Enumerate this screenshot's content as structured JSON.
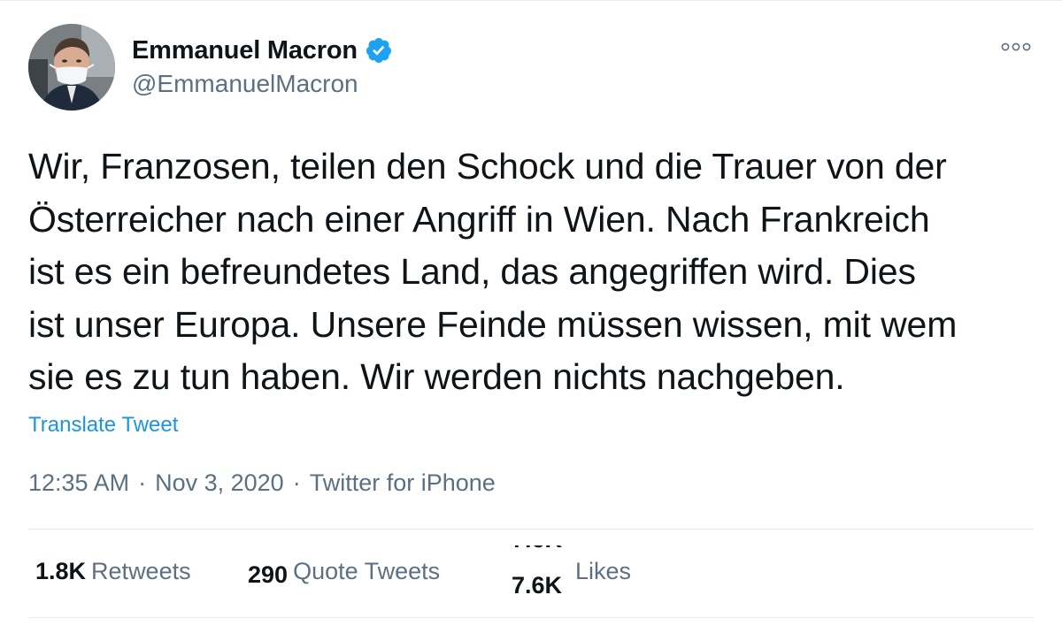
{
  "author": {
    "display_name": "Emmanuel Macron",
    "handle": "@EmmanuelMacron",
    "verified_icon": "verified-badge-icon",
    "verified_color": "#1da1f2"
  },
  "tweet": {
    "text": "Wir, Franzosen, teilen den Schock und die Trauer von der\nÖsterreicher nach einer Angriff in Wien. Nach Frankreich\nist es ein befreundetes Land, das angegriffen wird. Dies\nist unser Europa. Unsere Feinde müssen wissen, mit wem\nsie es zu tun haben. Wir werden nichts nachgeben.",
    "translate_label": "Translate Tweet",
    "time": "12:35 AM",
    "date": "Nov 3, 2020",
    "source": "Twitter for iPhone",
    "separator": "·"
  },
  "stats": {
    "retweets_count": "1.8K",
    "retweets_label": "Retweets",
    "quote_count": "290",
    "quote_label": "Quote Tweets",
    "likes_count": "7.6K",
    "likes_label": "Likes"
  },
  "colors": {
    "text": "#0f1419",
    "secondary": "#5b7083",
    "link": "#1b95e0",
    "divider": "#e6ecf0"
  }
}
